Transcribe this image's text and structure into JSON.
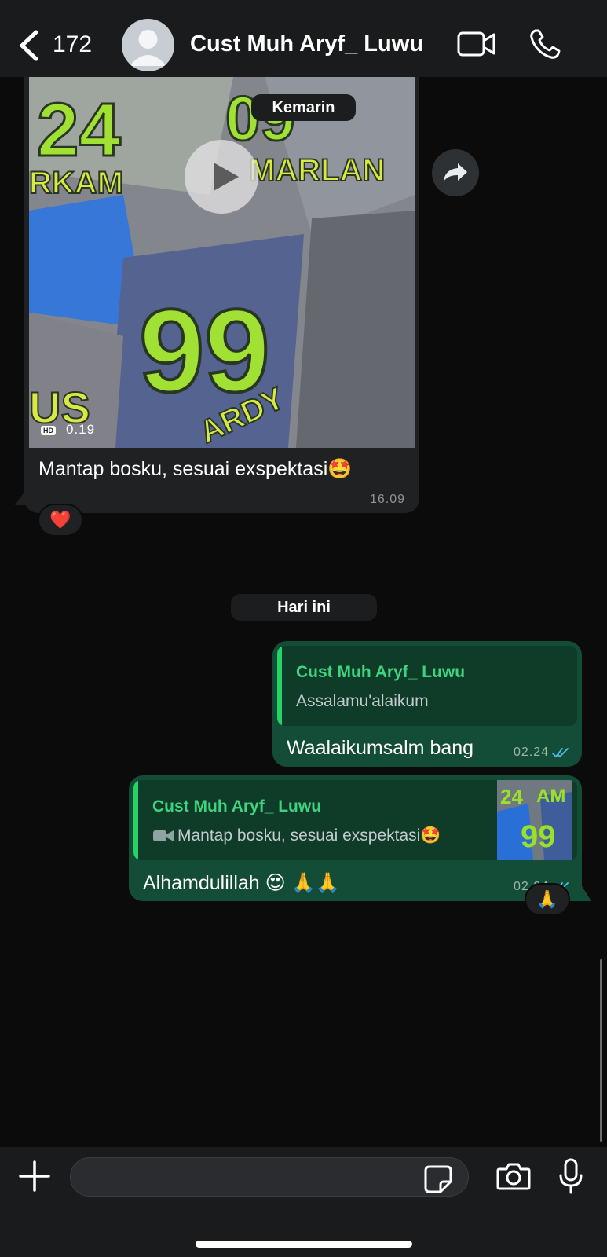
{
  "header": {
    "back_count": "172",
    "contact_name": "Cust Muh Aryf_ Luwu",
    "icons": [
      "chevron-left-icon",
      "avatar-placeholder-icon",
      "video-camera-icon",
      "phone-icon"
    ]
  },
  "chat": {
    "dates": {
      "yesterday": "Kemarin",
      "today": "Hari ini"
    },
    "incoming_video": {
      "duration": "0.19",
      "hd_badge": "HD",
      "caption": "Mantap bosku, sesuai exspektasi🤩",
      "time": "16.09",
      "reaction": "❤️"
    },
    "outgoing": [
      {
        "quote_name": "Cust Muh Aryf_ Luwu",
        "quote_text": "Assalamu'alaikum",
        "text": "Waalaikumsalm bang",
        "time": "02.24"
      },
      {
        "quote_name": "Cust Muh Aryf_ Luwu",
        "quote_text": "Mantap bosku, sesuai exspektasi🤩",
        "text": "Alhamdulillah 😍 🙏🙏",
        "time": "02.24",
        "reaction": "🙏"
      }
    ]
  },
  "composer": {
    "input_value": "",
    "input_placeholder": ""
  },
  "colors": {
    "header_bg": "#1a1b1d",
    "chat_bg": "#0b0b0b",
    "incoming_bubble": "#1f2123",
    "outgoing_bubble": "#144d37",
    "quote_accent": "#25d366",
    "read_ticks": "#53bdeb"
  }
}
